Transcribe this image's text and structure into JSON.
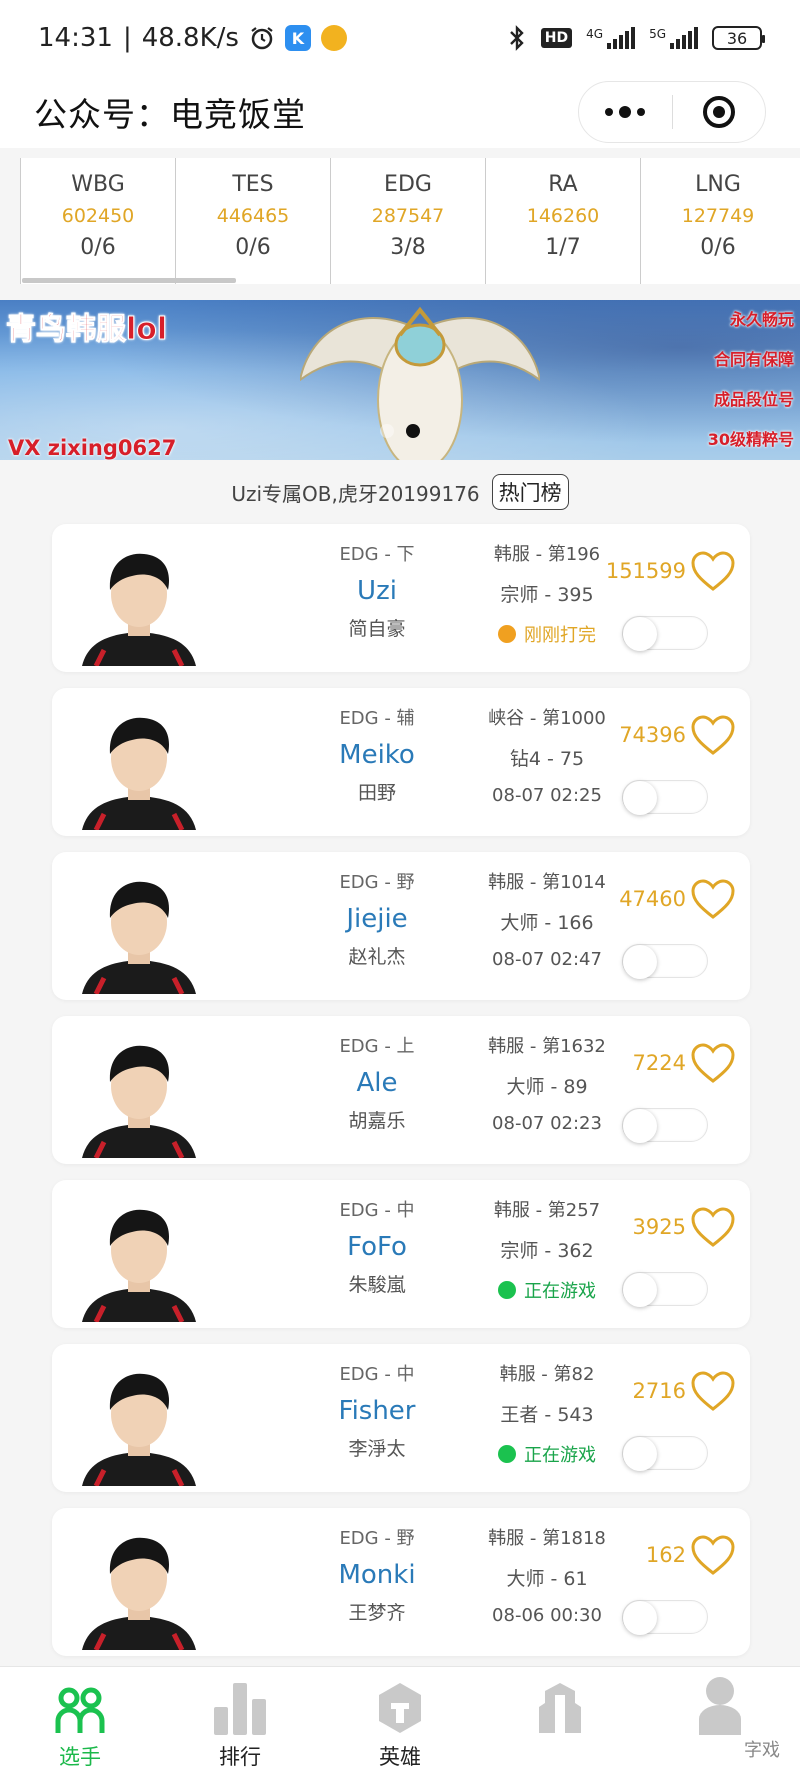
{
  "status_bar": {
    "time": "14:31",
    "speed": "48.8K/s",
    "hd": "HD",
    "net_4g": "4G",
    "net_5g": "5G",
    "battery": "36"
  },
  "header": {
    "title": "公众号：电竞饭堂"
  },
  "teams": [
    {
      "name": "WBG",
      "score": "602450",
      "record": "0/6"
    },
    {
      "name": "TES",
      "score": "446465",
      "record": "0/6"
    },
    {
      "name": "EDG",
      "score": "287547",
      "record": "3/8"
    },
    {
      "name": "RA",
      "score": "146260",
      "record": "1/7"
    },
    {
      "name": "LNG",
      "score": "127749",
      "record": "0/6"
    }
  ],
  "banner": {
    "title": "青鸟韩服lol",
    "vx": "VX zixing0627",
    "tags": [
      "永久畅玩",
      "合同有保障",
      "成品段位号",
      "30级精粹号"
    ]
  },
  "notice": {
    "text": "Uzi专属OB,虎牙20199176",
    "button": "热门榜"
  },
  "players": [
    {
      "meta": "EDG - 下",
      "name": "Uzi",
      "real": "简自豪",
      "server": "韩服 - 第196",
      "rank": "宗师 - 395",
      "state": "刚刚打完",
      "likes": "151599"
    },
    {
      "meta": "EDG - 辅",
      "name": "Meiko",
      "real": "田野",
      "server": "峡谷 - 第1000",
      "rank": "钻4 - 75",
      "state": "08-07 02:25",
      "likes": "74396"
    },
    {
      "meta": "EDG - 野",
      "name": "Jiejie",
      "real": "赵礼杰",
      "server": "韩服 - 第1014",
      "rank": "大师 - 166",
      "state": "08-07 02:47",
      "likes": "47460"
    },
    {
      "meta": "EDG - 上",
      "name": "Ale",
      "real": "胡嘉乐",
      "server": "韩服 - 第1632",
      "rank": "大师 - 89",
      "state": "08-07 02:23",
      "likes": "7224"
    },
    {
      "meta": "EDG - 中",
      "name": "FoFo",
      "real": "朱駿嵐",
      "server": "韩服 - 第257",
      "rank": "宗师 - 362",
      "state": "正在游戏",
      "likes": "3925"
    },
    {
      "meta": "EDG - 中",
      "name": "Fisher",
      "real": "李淨太",
      "server": "韩服 - 第82",
      "rank": "王者 - 543",
      "state": "正在游戏",
      "likes": "2716"
    },
    {
      "meta": "EDG - 野",
      "name": "Monki",
      "real": "王梦齐",
      "server": "韩服 - 第1818",
      "rank": "大师 - 61",
      "state": "08-06 00:30",
      "likes": "162"
    }
  ],
  "nav": {
    "items": [
      {
        "label": "选手"
      },
      {
        "label": "排行"
      },
      {
        "label": "英雄"
      },
      {
        "label": ""
      },
      {
        "label": ""
      }
    ]
  },
  "watermark": "字戏",
  "colors": {
    "accent_gold": "#e0a626",
    "name_blue": "#2a7ab8",
    "active_green": "#1bb84a",
    "banner_red": "#d71f2a"
  }
}
